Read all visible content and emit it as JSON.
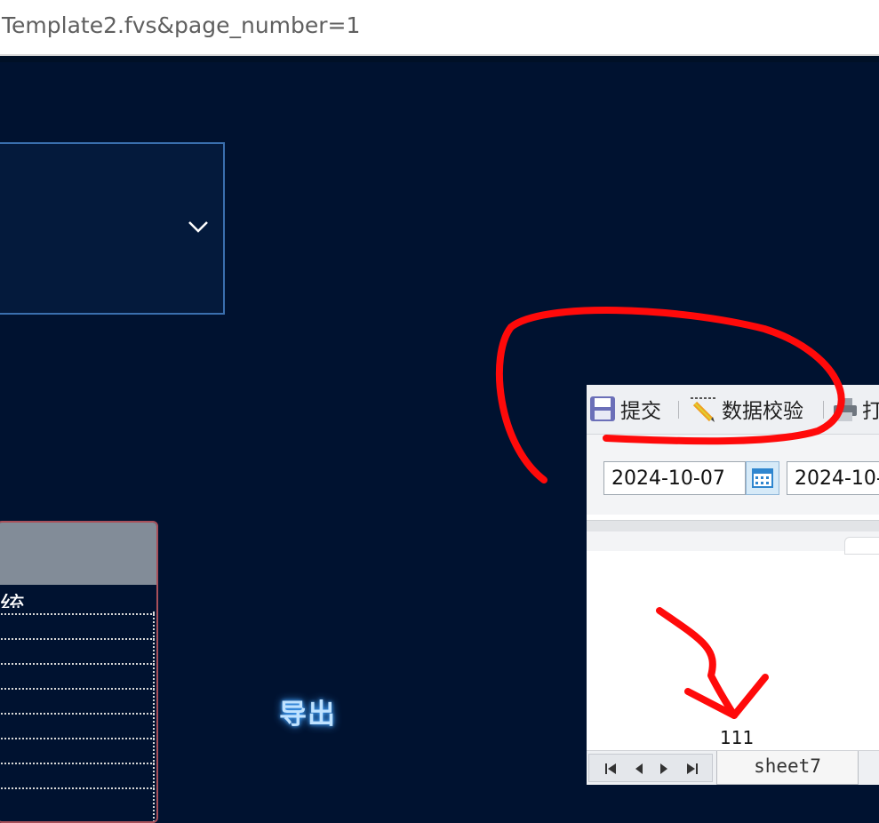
{
  "browser": {
    "url_text": "Template2.fvs&page_number=1"
  },
  "toolbar": {
    "submit_label": "提交",
    "validate_label": "数据校验",
    "print_label": "打"
  },
  "params": {
    "start_date": "2024-10-07",
    "end_date": "2024-10-"
  },
  "left_panel": {
    "clipped_heading": "统计"
  },
  "export_label": "导出",
  "report": {
    "cell_value": "111",
    "sheet_tab": "sheet7"
  },
  "colors": {
    "background": "#001230",
    "annotation": "#ff0a0a",
    "export_glow": "#3fa0ff"
  }
}
